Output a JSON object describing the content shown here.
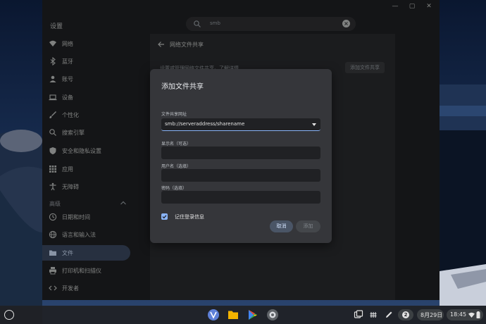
{
  "window": {
    "title": "设置"
  },
  "search": {
    "value": "smb"
  },
  "nav": {
    "items": [
      {
        "label": "网络"
      },
      {
        "label": "蓝牙"
      },
      {
        "label": "账号"
      },
      {
        "label": "设备"
      },
      {
        "label": "个性化"
      },
      {
        "label": "搜索引擎"
      },
      {
        "label": "安全和隐私设置"
      },
      {
        "label": "应用"
      },
      {
        "label": "无障碍"
      }
    ],
    "advanced_label": "高级",
    "advanced_items": [
      {
        "label": "日期和时间"
      },
      {
        "label": "语言和输入法"
      },
      {
        "label": "文件"
      },
      {
        "label": "打印机和扫描仪"
      },
      {
        "label": "开发者"
      }
    ]
  },
  "panel": {
    "title": "网络文件共享",
    "description": "设置或管理网络文件共享。了解详情",
    "add_button": "添加文件共享"
  },
  "dialog": {
    "title": "添加文件共享",
    "url_label": "文件共享网址",
    "url_value": "smb://serveraddress/sharename",
    "display_name_label": "显示名（可选）",
    "username_label": "用户名（选填）",
    "password_label": "密码（选填）",
    "remember_label": "记住登录信息",
    "remember_checked": true,
    "cancel_label": "取消",
    "add_label": "添加"
  },
  "shelf": {
    "date": "8月29日",
    "time": "18:45",
    "notification_count": "2"
  }
}
